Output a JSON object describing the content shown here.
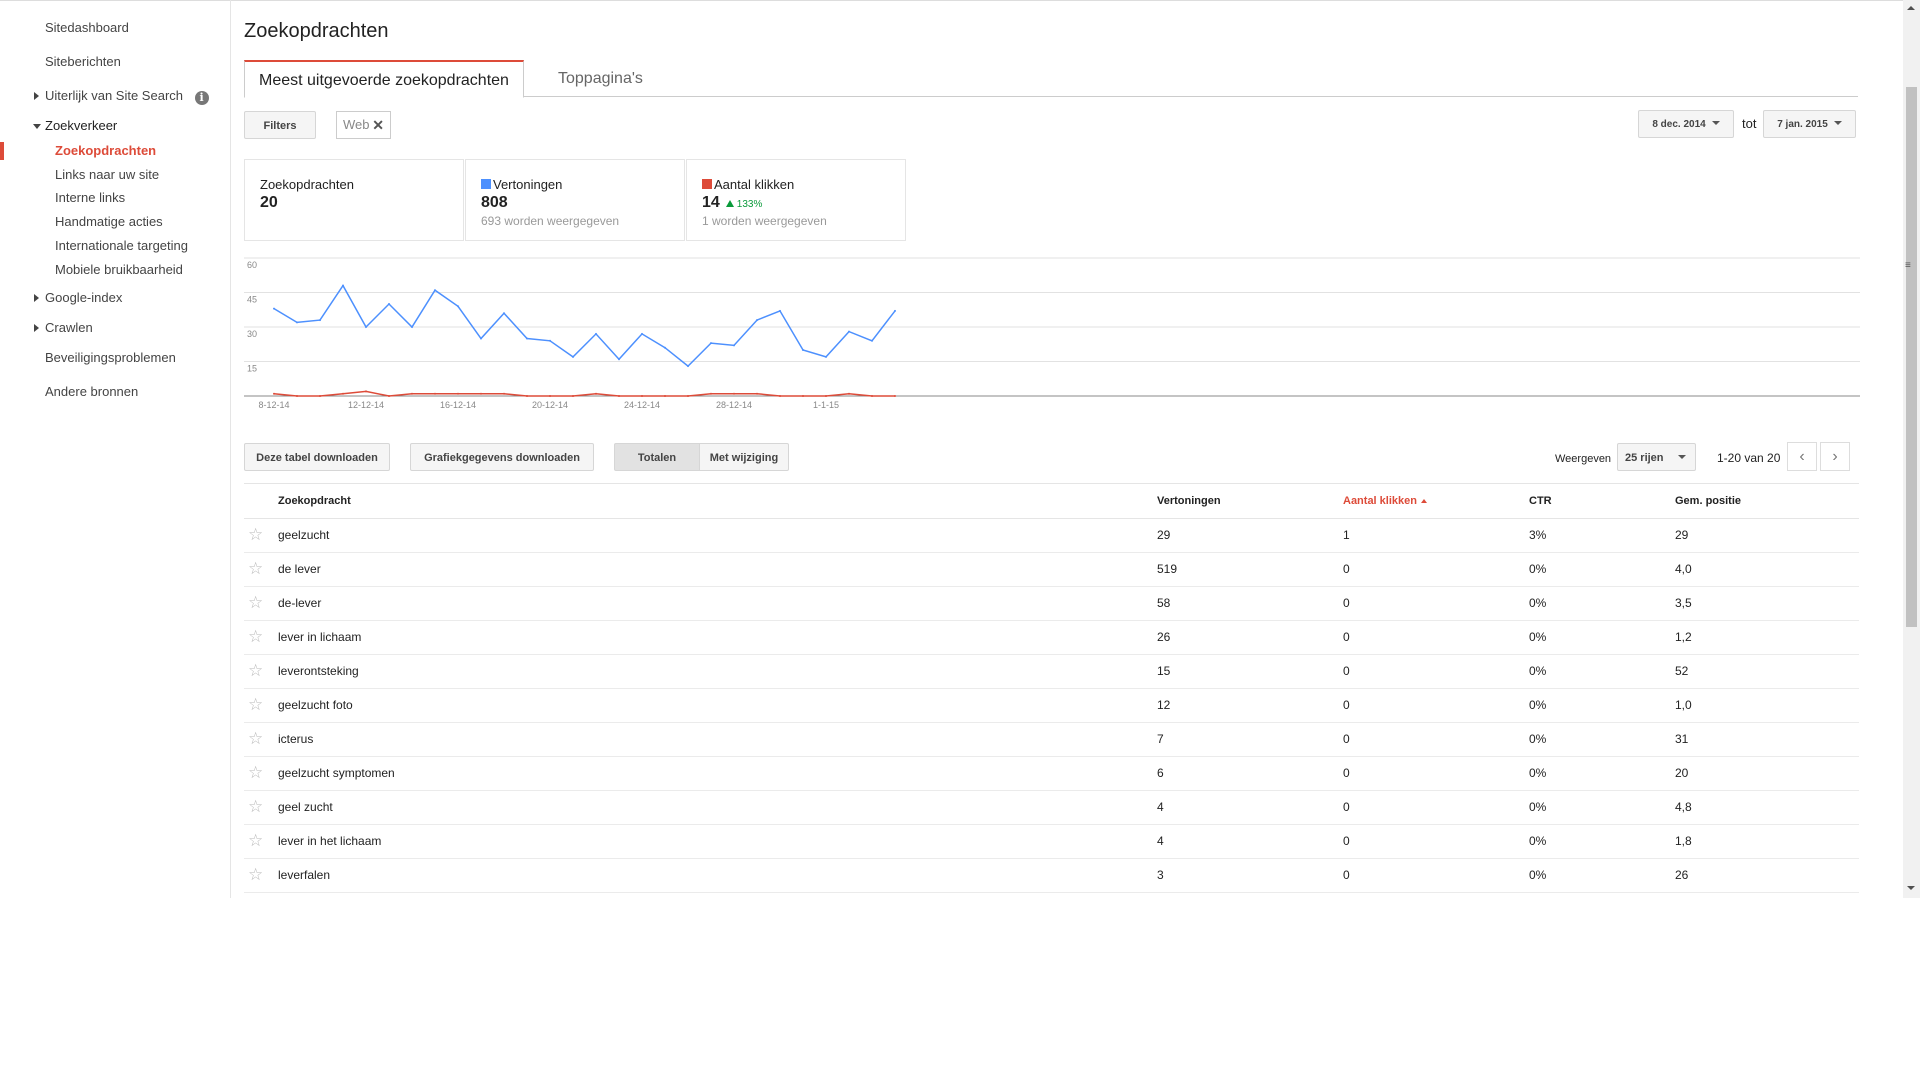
{
  "sidebar": {
    "items": [
      {
        "label": "Sitedashboard"
      },
      {
        "label": "Siteberichten"
      },
      {
        "label": "Uiterlijk van Site Search"
      },
      {
        "label": "Zoekverkeer"
      },
      {
        "label": "Zoekopdrachten"
      },
      {
        "label": "Links naar uw site"
      },
      {
        "label": "Interne links"
      },
      {
        "label": "Handmatige acties"
      },
      {
        "label": "Internationale targeting"
      },
      {
        "label": "Mobiele bruikbaarheid"
      },
      {
        "label": "Google-index"
      },
      {
        "label": "Crawlen"
      },
      {
        "label": "Beveiligingsproblemen"
      },
      {
        "label": "Andere bronnen"
      }
    ],
    "info_icon": "i"
  },
  "page": {
    "title": "Zoekopdrachten",
    "tabs": [
      {
        "label": "Meest uitgevoerde zoekopdrachten"
      },
      {
        "label": "Toppagina's"
      }
    ]
  },
  "filters": {
    "button_label": "Filters",
    "chip_label": "Web",
    "chip_close": "✕",
    "date_from": "8 dec. 2014",
    "date_sep": "tot",
    "date_to": "7 jan. 2015"
  },
  "stats": {
    "queries": {
      "label": "Zoekopdrachten",
      "value": "20"
    },
    "impressions": {
      "label": "Vertoningen",
      "value": "808",
      "sub": "693 worden weergegeven",
      "color": "#4d90fe"
    },
    "clicks": {
      "label": "Aantal klikken",
      "value": "14",
      "change": "133%",
      "sub": "1 worden weergegeven",
      "color": "#dd4b39"
    }
  },
  "chart_data": {
    "type": "line",
    "x": [
      "8-12-14",
      "9-12-14",
      "10-12-14",
      "11-12-14",
      "12-12-14",
      "13-12-14",
      "14-12-14",
      "15-12-14",
      "16-12-14",
      "17-12-14",
      "18-12-14",
      "19-12-14",
      "20-12-14",
      "21-12-14",
      "22-12-14",
      "23-12-14",
      "24-12-14",
      "25-12-14",
      "26-12-14",
      "27-12-14",
      "28-12-14",
      "29-12-14",
      "30-12-14",
      "31-12-14",
      "1-1-15",
      "2-1-15",
      "3-1-15",
      "4-1-15",
      "5-1-15",
      "6-1-15",
      "7-1-15"
    ],
    "tick_labels": [
      "8-12-14",
      "12-12-14",
      "16-12-14",
      "20-12-14",
      "24-12-14",
      "28-12-14",
      "1-1-15"
    ],
    "ylim": [
      0,
      60
    ],
    "yticks": [
      "60",
      "45",
      "30",
      "15"
    ],
    "series": [
      {
        "name": "Vertoningen",
        "color": "#4d90fe",
        "values": [
          38,
          32,
          33,
          48,
          30,
          40,
          30,
          46,
          39,
          25,
          36,
          25,
          24,
          17,
          27,
          16,
          27,
          21,
          13,
          23,
          22,
          33,
          37,
          20,
          17,
          28,
          24,
          37
        ]
      },
      {
        "name": "Aantal klikken",
        "color": "#dd4b39",
        "values": [
          1,
          0,
          0,
          1,
          2,
          0,
          1,
          1,
          1,
          1,
          1,
          0,
          0,
          0,
          1,
          0,
          0,
          0,
          0,
          1,
          1,
          1,
          0,
          0,
          0,
          1,
          0,
          0
        ]
      }
    ]
  },
  "toolbar": {
    "download_table": "Deze tabel downloaden",
    "download_chart": "Grafiekgegevens downloaden",
    "totals": "Totalen",
    "with_change": "Met wijziging",
    "rows_label": "Weergeven",
    "rows_value": "25 rijen",
    "range": "1-20 van 20",
    "prev": "‹",
    "next": "›"
  },
  "table": {
    "headers": [
      "Zoekopdracht",
      "Vertoningen",
      "Aantal klikken",
      "CTR",
      "Gem. positie"
    ],
    "rows": [
      {
        "query": "geelzucht",
        "impressions": "29",
        "clicks": "1",
        "ctr": "3%",
        "position": "29"
      },
      {
        "query": "de lever",
        "impressions": "519",
        "clicks": "0",
        "ctr": "0%",
        "position": "4,0"
      },
      {
        "query": "de-lever",
        "impressions": "58",
        "clicks": "0",
        "ctr": "0%",
        "position": "3,5"
      },
      {
        "query": "lever in lichaam",
        "impressions": "26",
        "clicks": "0",
        "ctr": "0%",
        "position": "1,2"
      },
      {
        "query": "leverontsteking",
        "impressions": "15",
        "clicks": "0",
        "ctr": "0%",
        "position": "52"
      },
      {
        "query": "geelzucht foto",
        "impressions": "12",
        "clicks": "0",
        "ctr": "0%",
        "position": "1,0"
      },
      {
        "query": "icterus",
        "impressions": "7",
        "clicks": "0",
        "ctr": "0%",
        "position": "31"
      },
      {
        "query": "geelzucht symptomen",
        "impressions": "6",
        "clicks": "0",
        "ctr": "0%",
        "position": "20"
      },
      {
        "query": "geel zucht",
        "impressions": "4",
        "clicks": "0",
        "ctr": "0%",
        "position": "4,8"
      },
      {
        "query": "lever in het lichaam",
        "impressions": "4",
        "clicks": "0",
        "ctr": "0%",
        "position": "1,8"
      },
      {
        "query": "leverfalen",
        "impressions": "3",
        "clicks": "0",
        "ctr": "0%",
        "position": "26"
      }
    ]
  }
}
